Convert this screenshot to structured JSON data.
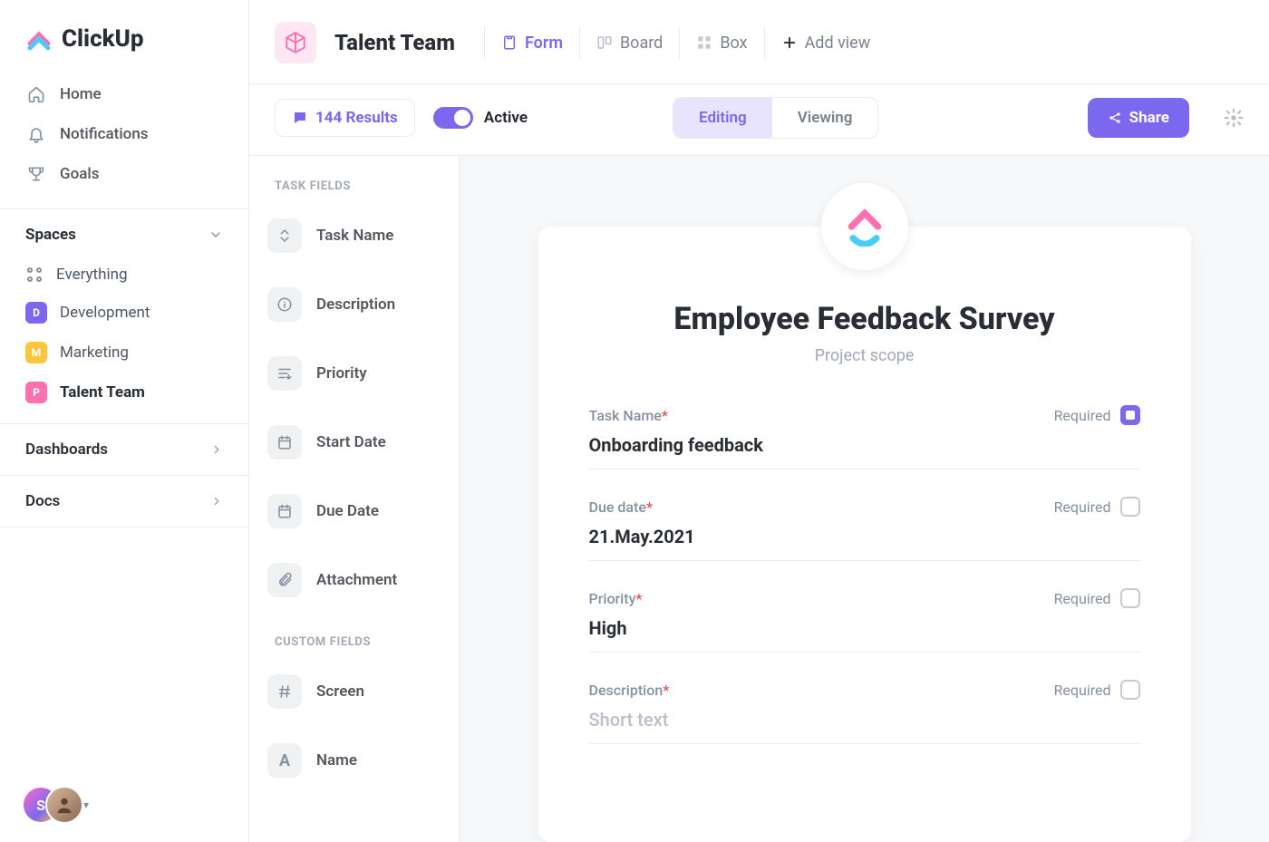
{
  "brand": "ClickUp",
  "nav": {
    "home": "Home",
    "notifications": "Notifications",
    "goals": "Goals"
  },
  "spaces": {
    "header": "Spaces",
    "everything": "Everything",
    "items": [
      {
        "badge": "D",
        "color": "#7b68ee",
        "label": "Development"
      },
      {
        "badge": "M",
        "color": "#ffc53d",
        "label": "Marketing"
      },
      {
        "badge": "P",
        "color": "#fd71af",
        "label": "Talent Team"
      }
    ]
  },
  "sections": {
    "dashboards": "Dashboards",
    "docs": "Docs"
  },
  "user": {
    "initial": "S"
  },
  "topbar": {
    "title": "Talent Team",
    "views": {
      "form": "Form",
      "board": "Board",
      "box": "Box",
      "add": "Add view"
    }
  },
  "subbar": {
    "results": "144 Results",
    "active": "Active",
    "editing": "Editing",
    "viewing": "Viewing",
    "share": "Share"
  },
  "fields": {
    "taskHeading": "TASK FIELDS",
    "customHeading": "CUSTOM FIELDS",
    "task": {
      "taskName": "Task Name",
      "description": "Description",
      "priority": "Priority",
      "startDate": "Start Date",
      "dueDate": "Due Date",
      "attachment": "Attachment"
    },
    "custom": {
      "screen": "Screen",
      "name": "Name"
    }
  },
  "form": {
    "title": "Employee Feedback Survey",
    "subtitle": "Project scope",
    "requiredLabel": "Required",
    "taskName": {
      "label": "Task Name",
      "value": "Onboarding feedback"
    },
    "dueDate": {
      "label": "Due date",
      "value": "21.May.2021"
    },
    "priority": {
      "label": "Priority",
      "value": "High"
    },
    "description": {
      "label": "Description",
      "placeholder": "Short text"
    }
  }
}
